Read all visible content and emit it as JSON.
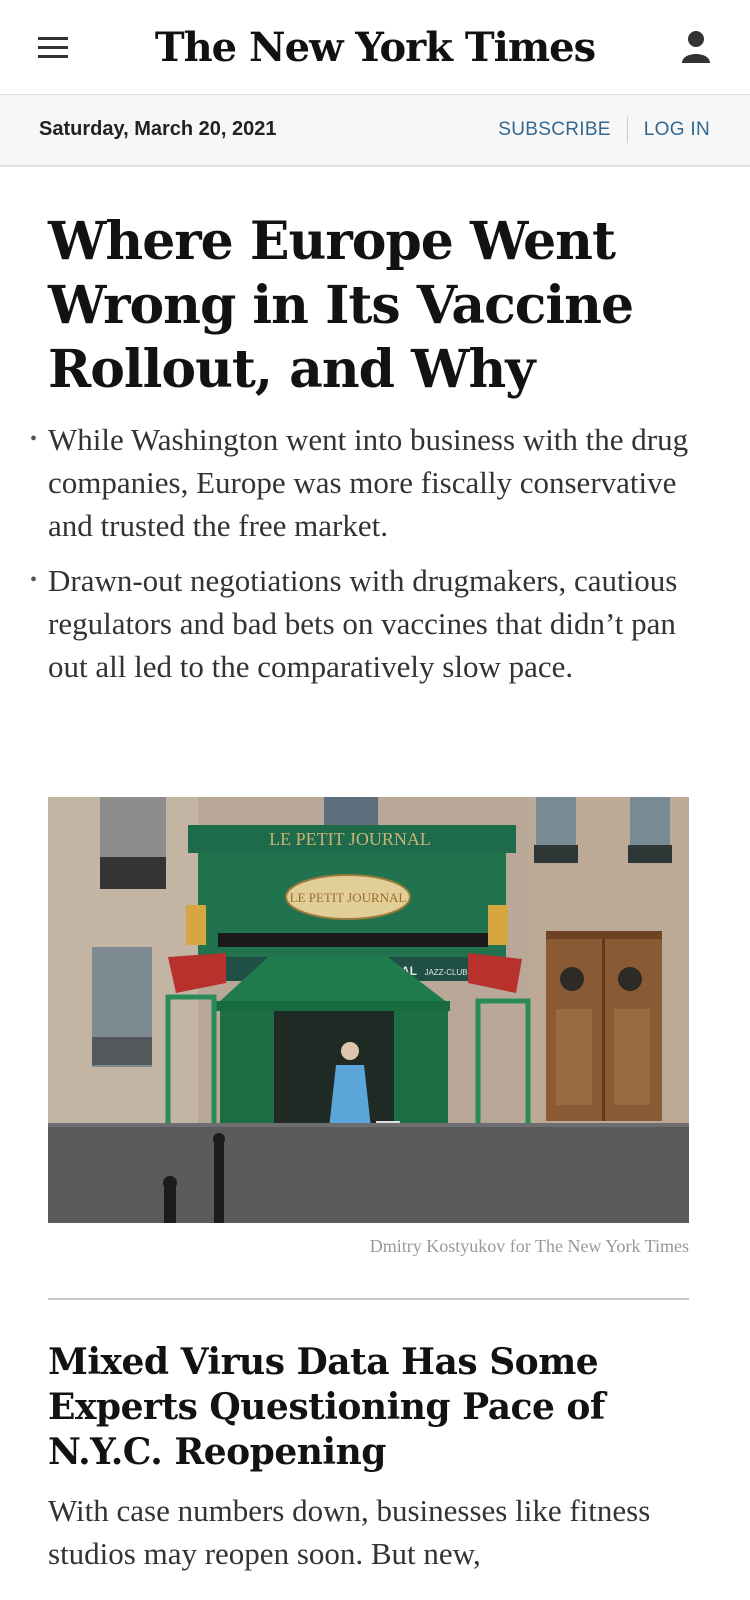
{
  "header": {
    "logo": "The New York Times",
    "menu_icon": "hamburger-menu-icon",
    "account_icon": "user-icon"
  },
  "datebar": {
    "date": "Saturday, March 20, 2021",
    "subscribe": "SUBSCRIBE",
    "login": "LOG IN",
    "link_color": "#326891"
  },
  "story1": {
    "headline": "Where Europe Went Wrong in Its Vaccine Rollout, and Why",
    "bullets": [
      "While Washington went into business with the drug companies, Europe was more fiscally conservative and trusted the free market.",
      "Drawn-out negotiations with drugmakers, cautious regulators and bad bets on vaccines that didn’t pan out all led to the comparatively slow pace."
    ],
    "image": {
      "sign_top": "LE PETIT JOURNAL",
      "sign_oval": "LE PETIT JOURNAL",
      "sign_lower": "JOURNAL",
      "sign_small": "JAZZ-CLUB"
    },
    "photo_credit": "Dmitry Kostyukov for The New York Times"
  },
  "story2": {
    "headline": "Mixed Virus Data Has Some Experts Questioning Pace of N.Y.C. Reopening",
    "summary": "With case numbers down, businesses like fitness studios may reopen soon. But new,"
  }
}
